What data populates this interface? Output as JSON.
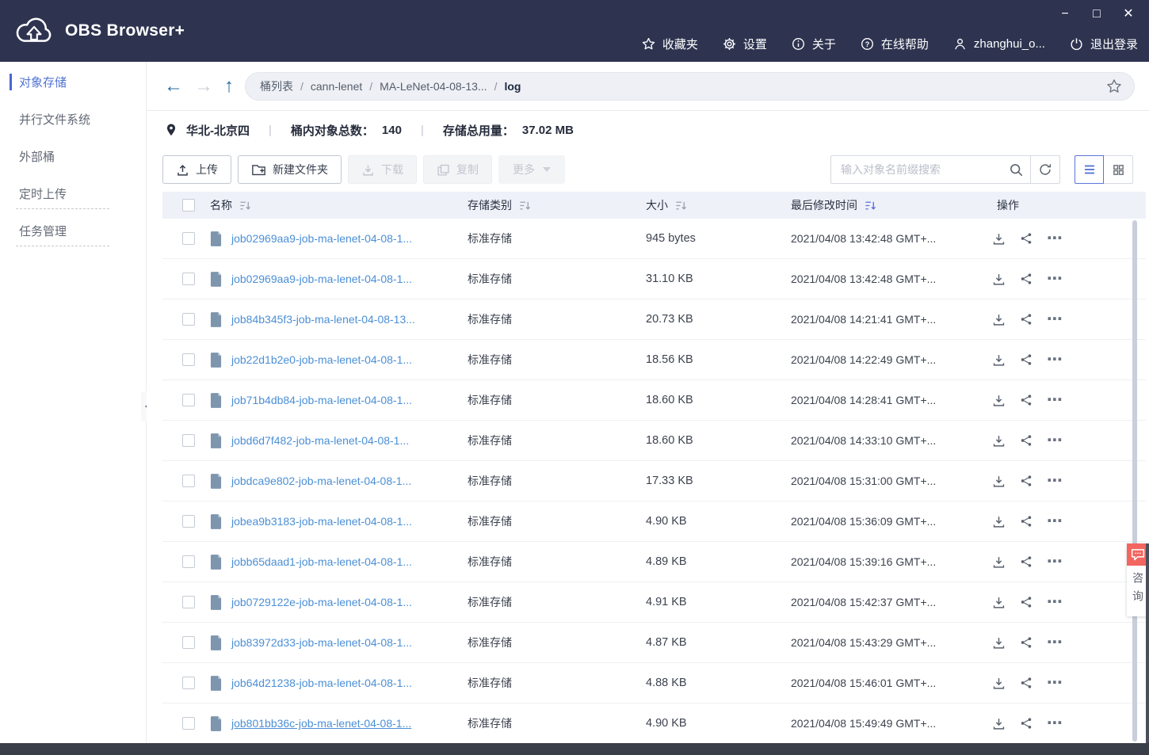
{
  "app": {
    "title": "OBS Browser+",
    "window_controls": {
      "minimize": "−",
      "maximize": "□",
      "close": "✕"
    }
  },
  "topnav": {
    "favorites": "收藏夹",
    "settings": "设置",
    "about": "关于",
    "help": "在线帮助",
    "user": "zhanghui_o...",
    "logout": "退出登录"
  },
  "sidebar": {
    "items": [
      {
        "label": "对象存储",
        "active": true
      },
      {
        "label": "并行文件系统",
        "active": false
      },
      {
        "label": "外部桶",
        "active": false
      },
      {
        "label": "定时上传",
        "active": false
      },
      {
        "label": "任务管理",
        "active": false
      }
    ]
  },
  "breadcrumb": {
    "separator": "/",
    "segments": [
      "桶列表",
      "cann-lenet",
      "MA-LeNet-04-08-13...",
      "log"
    ]
  },
  "bucket_info": {
    "region": "华北-北京四",
    "separator": "|",
    "objects_label": "桶内对象总数：",
    "objects_count": "140",
    "usage_label": "存储总用量：",
    "usage_value": "37.02 MB"
  },
  "toolbar": {
    "upload": "上传",
    "new_folder": "新建文件夹",
    "download": "下载",
    "copy": "复制",
    "more": "更多",
    "search_placeholder": "输入对象名前缀搜索"
  },
  "table": {
    "headers": {
      "name": "名称",
      "storage_class": "存储类别",
      "size": "大小",
      "modified": "最后修改时间",
      "operation": "操作"
    },
    "rows": [
      {
        "name": "job02969aa9-job-ma-lenet-04-08-1...",
        "storage_class": "标准存储",
        "size": "945 bytes",
        "modified": "2021/04/08 13:42:48 GMT+..."
      },
      {
        "name": "job02969aa9-job-ma-lenet-04-08-1...",
        "storage_class": "标准存储",
        "size": "31.10 KB",
        "modified": "2021/04/08 13:42:48 GMT+..."
      },
      {
        "name": "job84b345f3-job-ma-lenet-04-08-13...",
        "storage_class": "标准存储",
        "size": "20.73 KB",
        "modified": "2021/04/08 14:21:41 GMT+..."
      },
      {
        "name": "job22d1b2e0-job-ma-lenet-04-08-1...",
        "storage_class": "标准存储",
        "size": "18.56 KB",
        "modified": "2021/04/08 14:22:49 GMT+..."
      },
      {
        "name": "job71b4db84-job-ma-lenet-04-08-1...",
        "storage_class": "标准存储",
        "size": "18.60 KB",
        "modified": "2021/04/08 14:28:41 GMT+..."
      },
      {
        "name": "jobd6d7f482-job-ma-lenet-04-08-1...",
        "storage_class": "标准存储",
        "size": "18.60 KB",
        "modified": "2021/04/08 14:33:10 GMT+..."
      },
      {
        "name": "jobdca9e802-job-ma-lenet-04-08-1...",
        "storage_class": "标准存储",
        "size": "17.33 KB",
        "modified": "2021/04/08 15:31:00 GMT+..."
      },
      {
        "name": "jobea9b3183-job-ma-lenet-04-08-1...",
        "storage_class": "标准存储",
        "size": "4.90 KB",
        "modified": "2021/04/08 15:36:09 GMT+..."
      },
      {
        "name": "jobb65daad1-job-ma-lenet-04-08-1...",
        "storage_class": "标准存储",
        "size": "4.89 KB",
        "modified": "2021/04/08 15:39:16 GMT+..."
      },
      {
        "name": "job0729122e-job-ma-lenet-04-08-1...",
        "storage_class": "标准存储",
        "size": "4.91 KB",
        "modified": "2021/04/08 15:42:37 GMT+..."
      },
      {
        "name": "job83972d33-job-ma-lenet-04-08-1...",
        "storage_class": "标准存储",
        "size": "4.87 KB",
        "modified": "2021/04/08 15:43:29 GMT+..."
      },
      {
        "name": "job64d21238-job-ma-lenet-04-08-1...",
        "storage_class": "标准存储",
        "size": "4.88 KB",
        "modified": "2021/04/08 15:46:01 GMT+..."
      },
      {
        "name": "job801bb36c-job-ma-lenet-04-08-1...",
        "storage_class": "标准存储",
        "size": "4.90 KB",
        "modified": "2021/04/08 15:49:49 GMT+..."
      }
    ]
  },
  "consult": {
    "label": "咨询"
  },
  "colors": {
    "topbar_bg": "#2e3450",
    "sidebar_active": "#5173d4",
    "link_blue": "#4b8fd6",
    "table_header_bg": "#eef1f8",
    "nav_arrow_blue": "#2d6b9c",
    "consult_red": "#f2665f",
    "bottombar_bg": "#3a3e48"
  }
}
